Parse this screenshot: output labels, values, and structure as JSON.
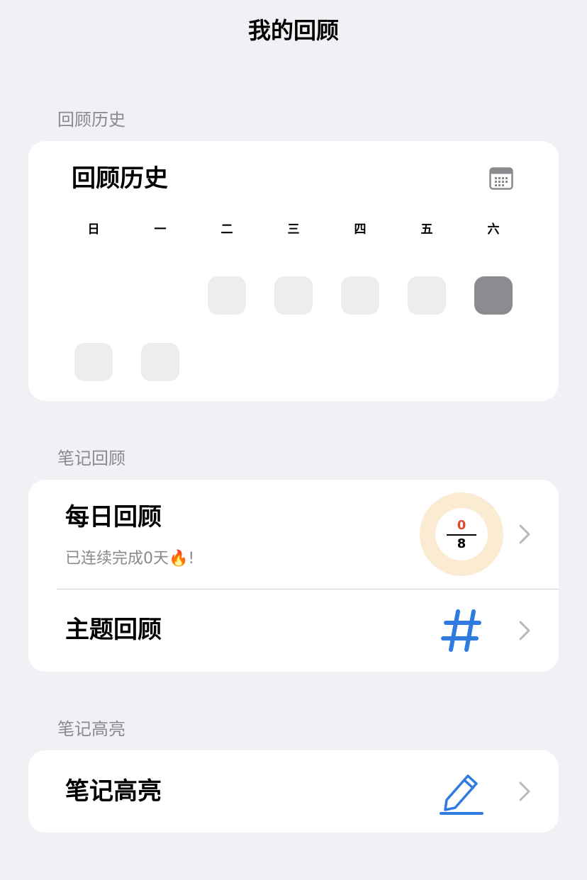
{
  "page": {
    "title": "我的回顾"
  },
  "history": {
    "section_label": "回顾历史",
    "title": "回顾历史",
    "weekdays": [
      "日",
      "一",
      "二",
      "三",
      "四",
      "五",
      "六"
    ]
  },
  "notes_review": {
    "section_label": "笔记回顾",
    "daily": {
      "title": "每日回顾",
      "subtitle": "已连续完成0天🔥!",
      "done": "0",
      "total": "8"
    },
    "topic": {
      "title": "主题回顾"
    }
  },
  "highlight": {
    "section_label": "笔记高亮",
    "title": "笔记高亮"
  },
  "colors": {
    "accent_blue": "#2f7be0",
    "ring_bg": "#fcebd3",
    "done_red": "#e04a2f",
    "cell_empty": "#ededee",
    "cell_today": "#8b8b90"
  },
  "icons": {
    "calendar": "calendar-icon",
    "chevron": "chevron-right-icon",
    "hash": "hash-icon",
    "pen": "pen-icon"
  }
}
